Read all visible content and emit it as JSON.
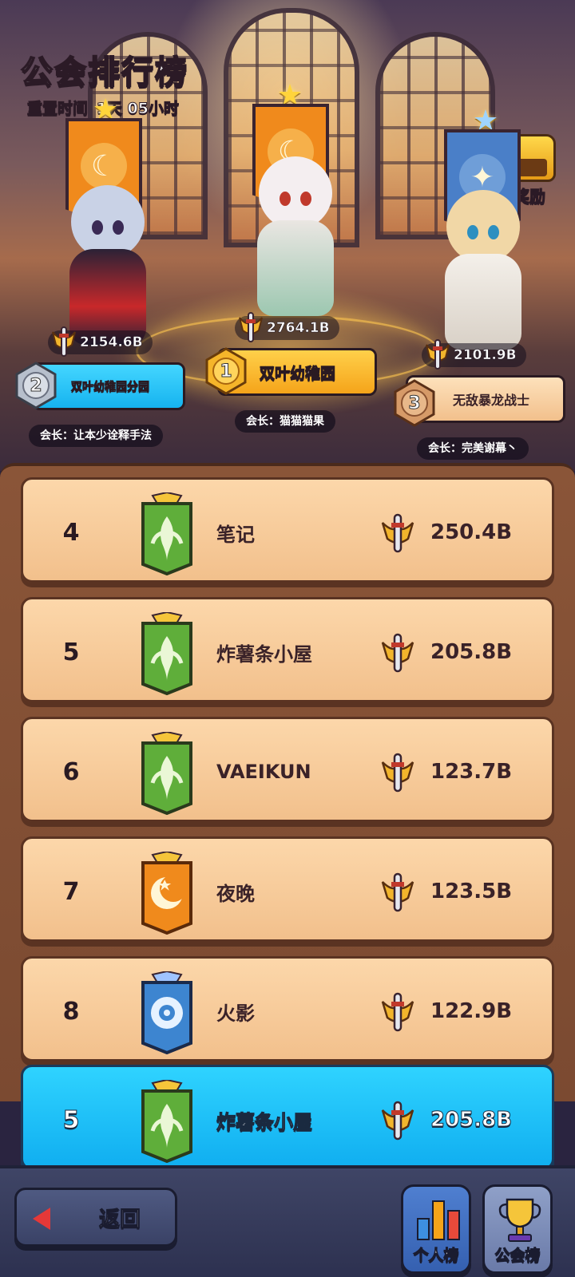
{
  "header": {
    "title": "公会排行榜",
    "reset_label": "重置时间",
    "reset_value": "1天 05小时",
    "reward_label": "奖励"
  },
  "podium": [
    {
      "rank": "2",
      "guild": "双叶幼稚园分园",
      "power": "2154.6B",
      "leader": "会长：让本少诠释手法",
      "banner_color": "#f08a1c",
      "medal_color": "#b7bfcc"
    },
    {
      "rank": "1",
      "guild": "双叶幼稚园",
      "power": "2764.1B",
      "leader": "会长：猫猫猫果",
      "banner_color": "#f08a1c",
      "medal_color": "#f5b52a"
    },
    {
      "rank": "3",
      "guild": "无敌暴龙战士",
      "power": "2101.9B",
      "leader": "会长：完美谢幕丶",
      "banner_color": "#4a7fc8",
      "medal_color": "#d69a68"
    }
  ],
  "rows": [
    {
      "rank": "4",
      "name": "笔记",
      "score": "250.4B",
      "flag": "green-leaf"
    },
    {
      "rank": "5",
      "name": "炸薯条小屋",
      "score": "205.8B",
      "flag": "green-leaf"
    },
    {
      "rank": "6",
      "name": "VAEIKUN",
      "score": "123.7B",
      "flag": "green-leaf"
    },
    {
      "rank": "7",
      "name": "夜晚",
      "score": "123.5B",
      "flag": "orange-moon"
    },
    {
      "rank": "8",
      "name": "火影",
      "score": "122.9B",
      "flag": "blue-eye"
    }
  ],
  "self_row": {
    "rank": "5",
    "name": "炸薯条小屋",
    "score": "205.8B",
    "flag": "green-leaf"
  },
  "footer": {
    "back_label": "返回",
    "personal_label": "个人榜",
    "guild_label": "公会榜"
  },
  "colors": {
    "row_bg": "#f6c894",
    "self_row_bg": "#1ab8f5",
    "board_bg": "#7b4a31",
    "flag_green": "#5fae3a",
    "flag_orange": "#f08a1c",
    "flag_blue": "#3d85d0"
  },
  "icons": [
    "sword-icon",
    "medal-icon",
    "banner-icon",
    "chest-icon",
    "back-arrow-icon",
    "bar-chart-icon",
    "trophy-icon"
  ]
}
